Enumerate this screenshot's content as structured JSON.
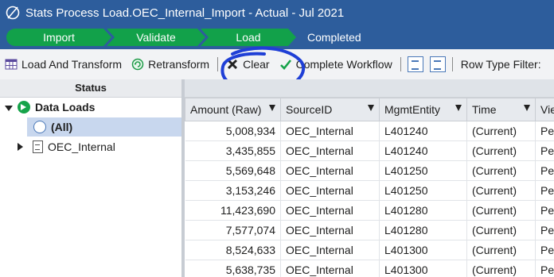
{
  "window": {
    "title": "Stats Process Load.OEC_Internal_Import  -  Actual  -  Jul 2021"
  },
  "workflow": {
    "steps": [
      "Import",
      "Validate",
      "Load"
    ],
    "status": "Completed",
    "step_color": "#12a14a"
  },
  "toolbar": {
    "load_transform": "Load And Transform",
    "retransform": "Retransform",
    "clear": "Clear",
    "complete_workflow": "Complete Workflow",
    "row_type_filter": "Row Type Filter:"
  },
  "left_panel": {
    "header": "Status",
    "root": "Data Loads",
    "all": "(All)",
    "child": "OEC_Internal"
  },
  "grid": {
    "columns": [
      "Amount (Raw)",
      "SourceID",
      "MgmtEntity",
      "Time",
      "View"
    ],
    "rows": [
      [
        "5,008,934",
        "OEC_Internal",
        "L401240",
        "(Current)",
        "Perio"
      ],
      [
        "3,435,855",
        "OEC_Internal",
        "L401240",
        "(Current)",
        "Perio"
      ],
      [
        "5,569,648",
        "OEC_Internal",
        "L401250",
        "(Current)",
        "Perio"
      ],
      [
        "3,153,246",
        "OEC_Internal",
        "L401250",
        "(Current)",
        "Perio"
      ],
      [
        "11,423,690",
        "OEC_Internal",
        "L401280",
        "(Current)",
        "Perio"
      ],
      [
        "7,577,074",
        "OEC_Internal",
        "L401280",
        "(Current)",
        "Perio"
      ],
      [
        "8,524,633",
        "OEC_Internal",
        "L401300",
        "(Current)",
        "Perio"
      ],
      [
        "5,638,735",
        "OEC_Internal",
        "L401300",
        "(Current)",
        "Perio"
      ]
    ]
  },
  "colors": {
    "header_blue": "#2d5d9c",
    "selection": "#c8d7ee",
    "annotation": "#1f3fd6"
  },
  "icons": [
    "app-logo-icon",
    "grid-icon",
    "retransform-icon",
    "clear-x-icon",
    "checkmark-icon",
    "document-icon",
    "export-icon",
    "green-go-icon",
    "circle-icon"
  ]
}
